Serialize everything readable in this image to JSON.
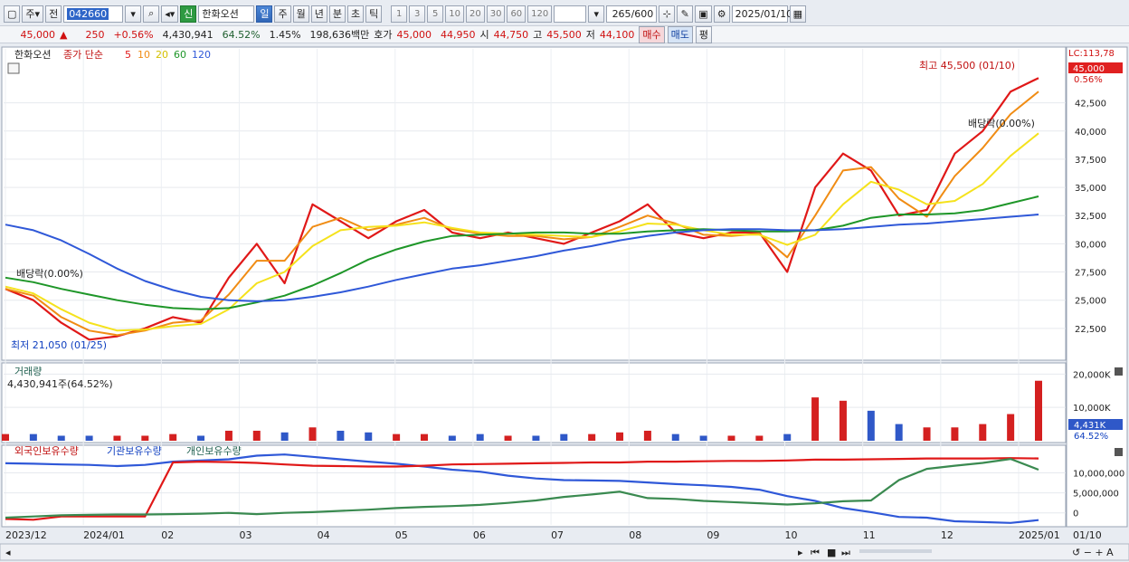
{
  "toolbar": {
    "type_label": "주",
    "prev_label": "전",
    "stock_code": "042660",
    "new_badge": "신",
    "stock_name": "한화오션",
    "periods": [
      "일",
      "주",
      "월",
      "년",
      "분",
      "초",
      "틱"
    ],
    "selected_period": "일",
    "intervals": [
      "1",
      "3",
      "5",
      "10",
      "20",
      "30",
      "60",
      "120"
    ],
    "count": "265",
    "count_max": "/600",
    "date": "2025/01/10"
  },
  "quote": {
    "price": "45,000",
    "change": "250",
    "change_pct": "+0.56%",
    "volume": "4,430,941",
    "volume_ratio": "64.52%",
    "turnover": "1.45%",
    "amount": "198,636백만",
    "ask_label": "호가",
    "ask": "45,000",
    "bid": "44,950",
    "open_label": "시",
    "open": "44,750",
    "high_label": "고",
    "high": "45,500",
    "low_label": "저",
    "low": "44,100",
    "buy_label": "매수",
    "sell_label": "매도",
    "eval_label": "평"
  },
  "price_panel": {
    "title": "한화오션",
    "ma_label": "종가 단순",
    "ma_periods": [
      "5",
      "10",
      "20",
      "60",
      "120"
    ],
    "high_note": "최고 45,500 (01/10)",
    "low_note": "최저 21,050 (01/25)",
    "div_note1": "배당락(0.00%)",
    "div_note2": "배당락(0.00%)",
    "lc_label": "LC:113,78",
    "current_tag": "45,000",
    "current_pct": "0.56%",
    "yticks": [
      "42,500",
      "40,000",
      "37,500",
      "35,000",
      "32,500",
      "30,000",
      "27,500",
      "25,000",
      "22,500"
    ]
  },
  "volume_panel": {
    "title": "거래량",
    "value": "4,430,941주(64.52%)",
    "yticks": [
      "20,000K",
      "10,000K"
    ],
    "current_tag": "4,431K",
    "current_pct": "64.52%"
  },
  "holdings_panel": {
    "legend": [
      "외국인보유수량",
      "기관보유수량",
      "개인보유수량"
    ],
    "yticks": [
      "10,000,000",
      "5,000,000",
      "0"
    ]
  },
  "x_axis": {
    "labels": [
      "2023/12",
      "2024/01",
      "02",
      "03",
      "04",
      "05",
      "06",
      "07",
      "08",
      "09",
      "10",
      "11",
      "12",
      "2025/01"
    ],
    "right_label": "01/10"
  },
  "chart_data": {
    "type": "candlestick",
    "ma_colors": {
      "5": "#e01818",
      "10": "#f08c14",
      "20": "#f5e21c",
      "60": "#1e9628",
      "120": "#2f58d8"
    },
    "series": [
      {
        "name": "5",
        "values": [
          26000,
          25000,
          23000,
          21500,
          21800,
          22500,
          23500,
          23000,
          27000,
          30000,
          26500,
          33500,
          32000,
          30500,
          32000,
          33000,
          31000,
          30500,
          31000,
          30500,
          30000,
          31000,
          32000,
          33500,
          31000,
          30500,
          31000,
          31000,
          27500,
          35000,
          38000,
          36500,
          32500,
          33000,
          38000,
          40000,
          43500,
          44700
        ]
      },
      {
        "name": "10",
        "values": [
          26000,
          25400,
          23500,
          22300,
          21900,
          22300,
          23000,
          23200,
          25500,
          28500,
          28500,
          31500,
          32300,
          31200,
          31700,
          32300,
          31300,
          30900,
          30700,
          30700,
          30400,
          30600,
          31500,
          32500,
          31800,
          30800,
          30700,
          30900,
          28800,
          32500,
          36500,
          36800,
          34000,
          32400,
          36000,
          38500,
          41500,
          43500
        ]
      },
      {
        "name": "20",
        "values": [
          26200,
          25600,
          24200,
          23000,
          22300,
          22400,
          22700,
          22900,
          24200,
          26500,
          27500,
          29800,
          31200,
          31500,
          31600,
          31900,
          31400,
          31000,
          30900,
          30800,
          30700,
          30600,
          31100,
          31800,
          31700,
          31200,
          30800,
          30800,
          29900,
          30800,
          33500,
          35500,
          34800,
          33500,
          33800,
          35300,
          37800,
          39800
        ]
      },
      {
        "name": "60",
        "values": [
          27000,
          26600,
          26000,
          25500,
          25000,
          24600,
          24300,
          24200,
          24300,
          24800,
          25400,
          26300,
          27400,
          28600,
          29500,
          30200,
          30700,
          30800,
          30900,
          31000,
          31000,
          30900,
          30900,
          31100,
          31200,
          31300,
          31200,
          31100,
          31100,
          31200,
          31600,
          32300,
          32600,
          32600,
          32700,
          33000,
          33600,
          34200
        ]
      },
      {
        "name": "120",
        "values": [
          31700,
          31200,
          30300,
          29100,
          27800,
          26700,
          25900,
          25300,
          25000,
          24900,
          25000,
          25300,
          25700,
          26200,
          26800,
          27300,
          27800,
          28100,
          28500,
          28900,
          29400,
          29800,
          30300,
          30700,
          31000,
          31200,
          31300,
          31300,
          31200,
          31200,
          31300,
          31500,
          31700,
          31800,
          32000,
          32200,
          32400,
          32600
        ]
      }
    ],
    "volume_level": [
      2,
      2,
      1.5,
      1.5,
      1.5,
      1.5,
      2,
      1.5,
      3,
      3,
      2.5,
      4,
      3,
      2.5,
      2,
      2,
      1.5,
      2,
      1.5,
      1.5,
      2,
      2,
      2.5,
      3,
      2,
      1.5,
      1.5,
      1.5,
      2,
      13,
      12,
      9,
      5,
      4,
      4,
      5,
      8,
      18
    ],
    "holdings": [
      {
        "name": "외국인보유수량",
        "color": "#2f58d8",
        "values": [
          12400000,
          12300000,
          12100000,
          12000000,
          11700000,
          12000000,
          12800000,
          13100000,
          13400000,
          14300000,
          14600000,
          14000000,
          13400000,
          12800000,
          12300000,
          11600000,
          10800000,
          10300000,
          9300000,
          8600000,
          8200000,
          8100000,
          8000000,
          7600000,
          7200000,
          6900000,
          6500000,
          5800000,
          4200000,
          3000000,
          1200000,
          200000,
          -1000000,
          -1200000,
          -2100000,
          -2300000,
          -2500000,
          -1800000
        ]
      },
      {
        "name": "기관보유수량",
        "color": "#e01818",
        "values": [
          -1500000,
          -1700000,
          -900000,
          -900000,
          -900000,
          -900000,
          12600000,
          12800000,
          12700000,
          12500000,
          12100000,
          11800000,
          11700000,
          11600000,
          11600000,
          11800000,
          12100000,
          12200000,
          12300000,
          12400000,
          12500000,
          12600000,
          12600000,
          12800000,
          12800000,
          12900000,
          13000000,
          13000000,
          13100000,
          13300000,
          13300000,
          13400000,
          13500000,
          13600000,
          13600000,
          13600000,
          13700000,
          13600000
        ]
      },
      {
        "name": "개인보유수량",
        "color": "#3a8a50",
        "values": [
          -1200000,
          -900000,
          -600000,
          -500000,
          -400000,
          -400000,
          -300000,
          -200000,
          0,
          -300000,
          0,
          200000,
          500000,
          800000,
          1200000,
          1500000,
          1700000,
          2000000,
          2500000,
          3100000,
          4000000,
          4600000,
          5300000,
          3700000,
          3500000,
          3000000,
          2700000,
          2400000,
          2100000,
          2400000,
          2900000,
          3100000,
          8200000,
          11000000,
          11800000,
          12500000,
          13500000,
          10800000
        ]
      }
    ],
    "price_range": [
      20000,
      46000
    ],
    "volume_range": [
      0,
      22000
    ],
    "holdings_range": [
      -3000000,
      16000000
    ]
  }
}
